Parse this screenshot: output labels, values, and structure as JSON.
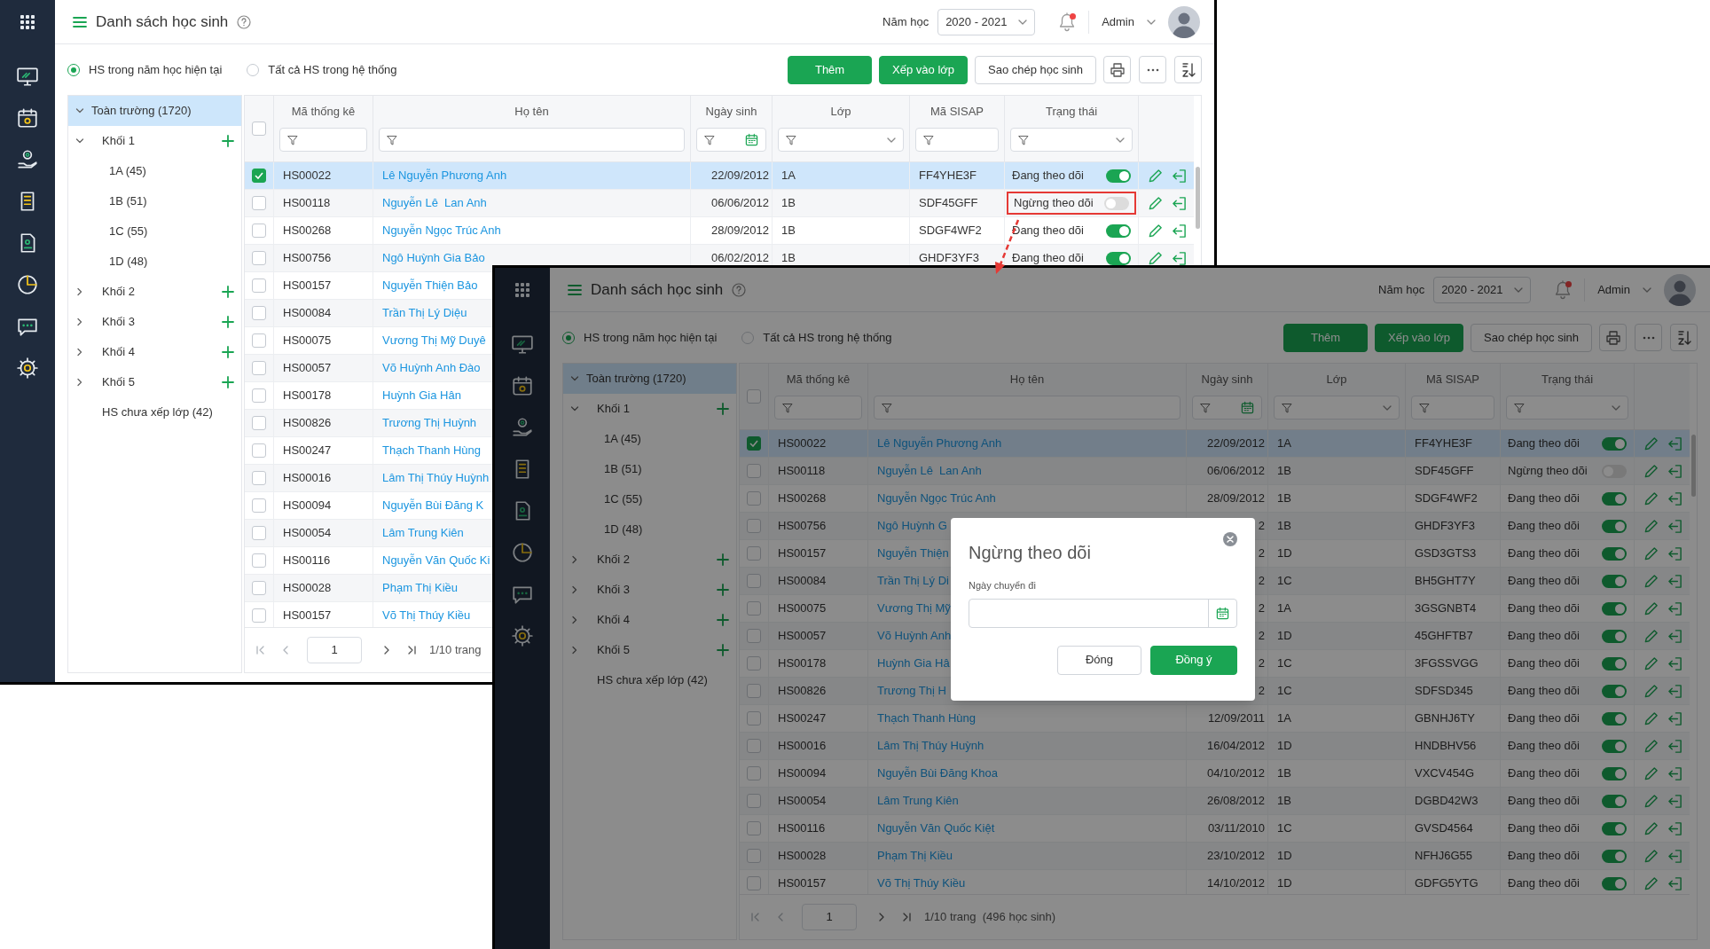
{
  "back_window": {
    "header": {
      "title": "Danh sách học sinh",
      "year_label": "Năm học",
      "year": "2020 - 2021",
      "unread": true,
      "user": "Admin"
    },
    "scope_options": [
      {
        "label": "HS trong năm học hiện tại",
        "selected": true
      },
      {
        "label": "Tất cả HS trong hệ thống",
        "selected": false
      }
    ],
    "toolbar_buttons": [
      {
        "label": "Thêm",
        "kind": "primary"
      },
      {
        "label": "Xếp vào lớp",
        "kind": "primary"
      },
      {
        "label": "Sao chép học sinh",
        "kind": "outline"
      }
    ],
    "tree": [
      {
        "label": "Toàn trường (1720)",
        "kind": "school",
        "selected": true,
        "expanded": true,
        "children": [
          {
            "label": "Khối 1",
            "kind": "grade",
            "selected": false,
            "expanded": true,
            "children": [
              {
                "label": "1A (45)",
                "kind": "class",
                "selected": false
              },
              {
                "label": "1B (51)",
                "kind": "class",
                "selected": false
              },
              {
                "label": "1C (55)",
                "kind": "class",
                "selected": false
              },
              {
                "label": "1D (48)",
                "kind": "class",
                "selected": false
              }
            ]
          },
          {
            "label": "Khối 2",
            "kind": "grade",
            "selected": false,
            "expanded": false
          },
          {
            "label": "Khối 3",
            "kind": "grade",
            "selected": false,
            "expanded": false
          },
          {
            "label": "Khối 4",
            "kind": "grade",
            "selected": false,
            "expanded": false
          },
          {
            "label": "Khối 5",
            "kind": "grade",
            "selected": false,
            "expanded": false
          },
          {
            "label": "HS chưa xếp lớp (42)",
            "kind": "unassigned",
            "selected": false
          }
        ]
      }
    ],
    "columns": [
      {
        "label": "Mã thống kê",
        "kind": "text"
      },
      {
        "label": "Họ tên",
        "kind": "text"
      },
      {
        "label": "Ngày sinh",
        "kind": "date"
      },
      {
        "label": "Lớp",
        "kind": "select"
      },
      {
        "label": "Mã SISAP",
        "kind": "text"
      },
      {
        "label": "Trạng thái",
        "kind": "select"
      }
    ],
    "all_checked": false,
    "rows": [
      {
        "code": "HS00022",
        "name": "Lê Nguyễn Phương Anh",
        "dob": "22/09/2012",
        "class": "1A",
        "sisap": "FF4YHE3F",
        "status": "Đang theo dõi",
        "tracking": true,
        "checked": true,
        "marked": false
      },
      {
        "code": "HS00118",
        "name": "Nguyễn Lê  Lan Anh",
        "dob": "06/06/2012",
        "class": "1B",
        "sisap": "SDF45GFF",
        "status": "Ngừng theo dõi",
        "tracking": false,
        "checked": false,
        "marked": true
      },
      {
        "code": "HS00268",
        "name": "Nguyễn Ngọc Trúc Anh",
        "dob": "28/09/2012",
        "class": "1B",
        "sisap": "SDGF4WF2",
        "status": "Đang theo dõi",
        "tracking": true,
        "checked": false,
        "marked": false
      },
      {
        "code": "HS00756",
        "name": "Ngô Huỳnh Gia Bảo",
        "dob": "06/02/2012",
        "class": "1B",
        "sisap": "GHDF3YF3",
        "status": "Đang theo dõi",
        "tracking": true,
        "checked": false,
        "marked": false
      },
      {
        "code": "HS00157",
        "name": "Nguyễn Thiện Bảo",
        "checked": false
      },
      {
        "code": "HS00084",
        "name": "Trần Thị Lý Diệu",
        "checked": false
      },
      {
        "code": "HS00075",
        "name": "Vương Thị Mỹ Duyê",
        "checked": false
      },
      {
        "code": "HS00057",
        "name": "Võ Huỳnh Anh Đào",
        "checked": false
      },
      {
        "code": "HS00178",
        "name": "Huỳnh Gia Hân",
        "checked": false
      },
      {
        "code": "HS00826",
        "name": "Trương Thị Huỳnh",
        "checked": false
      },
      {
        "code": "HS00247",
        "name": "Thạch Thanh Hùng",
        "checked": false
      },
      {
        "code": "HS00016",
        "name": "Lâm Thị Thúy Huỳnh",
        "checked": false
      },
      {
        "code": "HS00094",
        "name": "Nguyễn Bùi Đăng K",
        "checked": false
      },
      {
        "code": "HS00054",
        "name": "Lâm Trung Kiên",
        "checked": false
      },
      {
        "code": "HS00116",
        "name": "Nguyễn Văn Quốc Ki",
        "checked": false
      },
      {
        "code": "HS00028",
        "name": "Phạm Thị Kiều",
        "checked": false
      },
      {
        "code": "HS00157",
        "name": "Võ Thị Thúy Kiều",
        "checked": false
      }
    ],
    "pagination": {
      "page": "1",
      "summary": "1/10 trang"
    }
  },
  "front_window": {
    "header": {
      "title": "Danh sách học sinh",
      "year_label": "Năm học",
      "year": "2020 - 2021",
      "unread": true,
      "user": "Admin"
    },
    "scope_options": [
      {
        "label": "HS trong năm học hiện tại",
        "selected": true
      },
      {
        "label": "Tất cả HS trong hệ thống",
        "selected": false
      }
    ],
    "toolbar_buttons": [
      {
        "label": "Thêm",
        "kind": "primary"
      },
      {
        "label": "Xếp vào lớp",
        "kind": "primary"
      },
      {
        "label": "Sao chép học sinh",
        "kind": "outline"
      }
    ],
    "tree": [
      {
        "label": "Toàn trường (1720)",
        "kind": "school",
        "selected": true,
        "expanded": true,
        "children": [
          {
            "label": "Khối 1",
            "kind": "grade",
            "selected": false,
            "expanded": true,
            "children": [
              {
                "label": "1A (45)",
                "kind": "class",
                "selected": false
              },
              {
                "label": "1B (51)",
                "kind": "class",
                "selected": false
              },
              {
                "label": "1C (55)",
                "kind": "class",
                "selected": false
              },
              {
                "label": "1D (48)",
                "kind": "class",
                "selected": false
              }
            ]
          },
          {
            "label": "Khối 2",
            "kind": "grade",
            "selected": false,
            "expanded": false
          },
          {
            "label": "Khối 3",
            "kind": "grade",
            "selected": false,
            "expanded": false
          },
          {
            "label": "Khối 4",
            "kind": "grade",
            "selected": false,
            "expanded": false
          },
          {
            "label": "Khối 5",
            "kind": "grade",
            "selected": false,
            "expanded": false
          },
          {
            "label": "HS chưa xếp lớp (42)",
            "kind": "unassigned",
            "selected": false
          }
        ]
      }
    ],
    "columns": [
      {
        "label": "Mã thống kê",
        "kind": "text"
      },
      {
        "label": "Họ tên",
        "kind": "text"
      },
      {
        "label": "Ngày sinh",
        "kind": "date"
      },
      {
        "label": "Lớp",
        "kind": "select"
      },
      {
        "label": "Mã SISAP",
        "kind": "text"
      },
      {
        "label": "Trạng thái",
        "kind": "select"
      }
    ],
    "all_checked": false,
    "rows": [
      {
        "code": "HS00022",
        "name": "Lê Nguyễn Phương Anh",
        "dob": "22/09/2012",
        "class": "1A",
        "sisap": "FF4YHE3F",
        "status": "Đang theo dõi",
        "tracking": true,
        "checked": true
      },
      {
        "code": "HS00118",
        "name": "Nguyễn Lê  Lan Anh",
        "dob": "06/06/2012",
        "class": "1B",
        "sisap": "SDF45GFF",
        "status": "Ngừng theo dõi",
        "tracking": false,
        "checked": false
      },
      {
        "code": "HS00268",
        "name": "Nguyễn Ngọc Trúc Anh",
        "dob": "28/09/2012",
        "class": "1B",
        "sisap": "SDGF4WF2",
        "status": "Đang theo dõi",
        "tracking": true,
        "checked": false
      },
      {
        "code": "HS00756",
        "name": "Ngô Huỳnh G",
        "dob": "2",
        "class": "1B",
        "sisap": "GHDF3YF3",
        "status": "Đang theo dõi",
        "tracking": true,
        "checked": false
      },
      {
        "code": "HS00157",
        "name": "Nguyễn Thiện",
        "dob": "2",
        "class": "1D",
        "sisap": "GSD3GTS3",
        "status": "Đang theo dõi",
        "tracking": true,
        "checked": false
      },
      {
        "code": "HS00084",
        "name": "Trần Thị Lý Di",
        "dob": "2",
        "class": "1C",
        "sisap": "BH5GHT7Y",
        "status": "Đang theo dõi",
        "tracking": true,
        "checked": false
      },
      {
        "code": "HS00075",
        "name": "Vương Thị Mỹ",
        "dob": "2",
        "class": "1A",
        "sisap": "3GSGNBT4",
        "status": "Đang theo dõi",
        "tracking": true,
        "checked": false
      },
      {
        "code": "HS00057",
        "name": "Võ Huỳnh Anh",
        "dob": "2",
        "class": "1D",
        "sisap": "45GHFTB7",
        "status": "Đang theo dõi",
        "tracking": true,
        "checked": false
      },
      {
        "code": "HS00178",
        "name": "Huỳnh Gia Hâ",
        "dob": "2",
        "class": "1C",
        "sisap": "3FGSSVGG",
        "status": "Đang theo dõi",
        "tracking": true,
        "checked": false
      },
      {
        "code": "HS00826",
        "name": "Trương Thị H",
        "dob": "2",
        "class": "1C",
        "sisap": "SDFSD345",
        "status": "Đang theo dõi",
        "tracking": true,
        "checked": false
      },
      {
        "code": "HS00247",
        "name": "Thạch Thanh Hùng",
        "dob": "12/09/2011",
        "class": "1A",
        "sisap": "GBNHJ6TY",
        "status": "Đang theo dõi",
        "tracking": true,
        "checked": false
      },
      {
        "code": "HS00016",
        "name": "Lâm Thị Thúy Huỳnh",
        "dob": "16/04/2012",
        "class": "1D",
        "sisap": "HNDBHV56",
        "status": "Đang theo dõi",
        "tracking": true,
        "checked": false
      },
      {
        "code": "HS00094",
        "name": "Nguyễn Bùi Đăng Khoa",
        "dob": "04/10/2012",
        "class": "1B",
        "sisap": "VXCV454G",
        "status": "Đang theo dõi",
        "tracking": true,
        "checked": false
      },
      {
        "code": "HS00054",
        "name": "Lâm Trung Kiên",
        "dob": "26/08/2012",
        "class": "1B",
        "sisap": "DGBD42W3",
        "status": "Đang theo dõi",
        "tracking": true,
        "checked": false
      },
      {
        "code": "HS00116",
        "name": "Nguyễn Văn Quốc Kiệt",
        "dob": "03/11/2010",
        "class": "1C",
        "sisap": "GVSD4564",
        "status": "Đang theo dõi",
        "tracking": true,
        "checked": false
      },
      {
        "code": "HS00028",
        "name": "Phạm Thị Kiều",
        "dob": "23/10/2012",
        "class": "1D",
        "sisap": "NFHJ6G55",
        "status": "Đang theo dõi",
        "tracking": true,
        "checked": false
      },
      {
        "code": "HS00157",
        "name": "Võ Thị Thúy Kiều",
        "dob": "14/10/2012",
        "class": "1D",
        "sisap": "GDFG5YTG",
        "status": "Đang theo dõi",
        "tracking": true,
        "checked": false
      }
    ],
    "pagination": {
      "page": "1",
      "summary": "1/10 trang  (496 học sinh)"
    },
    "dialog": {
      "title": "Ngừng theo dõi",
      "field_label": "Ngày chuyển đi",
      "buttons": [
        {
          "label": "Đóng",
          "kind": "outline"
        },
        {
          "label": "Đồng ý",
          "kind": "primary"
        }
      ]
    }
  }
}
